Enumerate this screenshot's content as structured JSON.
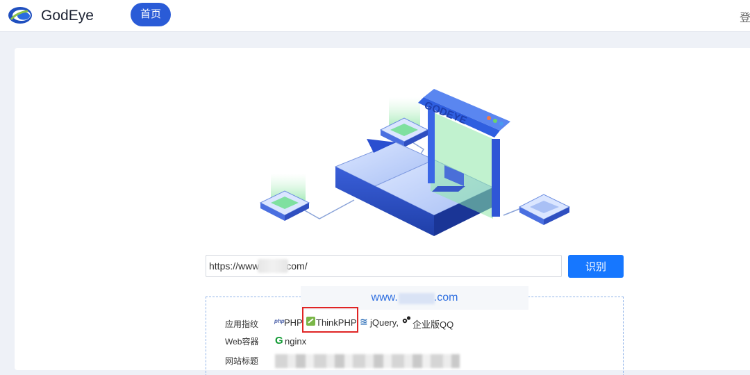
{
  "header": {
    "brand": "GodEye",
    "nav_home": "首页",
    "login": "登"
  },
  "illustration": {
    "sign_text": "GODEYE"
  },
  "search": {
    "url_value": "https://www          com/",
    "button_label": "识别"
  },
  "result": {
    "domain_prefix": "www.",
    "domain_suffix": ".com",
    "rows": {
      "app_fingerprint_label": "应用指纹",
      "web_container_label": "Web容器",
      "site_title_label": "网站标题"
    },
    "fingerprints": [
      "PHP",
      "ThinkPHP",
      "jQuery,",
      "企业版QQ"
    ],
    "php_logo_text": "php",
    "web_container": "nginx",
    "nginx_logo_text": "G"
  },
  "colors": {
    "accent": "#1677ff",
    "nav_active": "#2a5bd7",
    "highlight": "#e02424",
    "domain": "#2f6fe0"
  }
}
